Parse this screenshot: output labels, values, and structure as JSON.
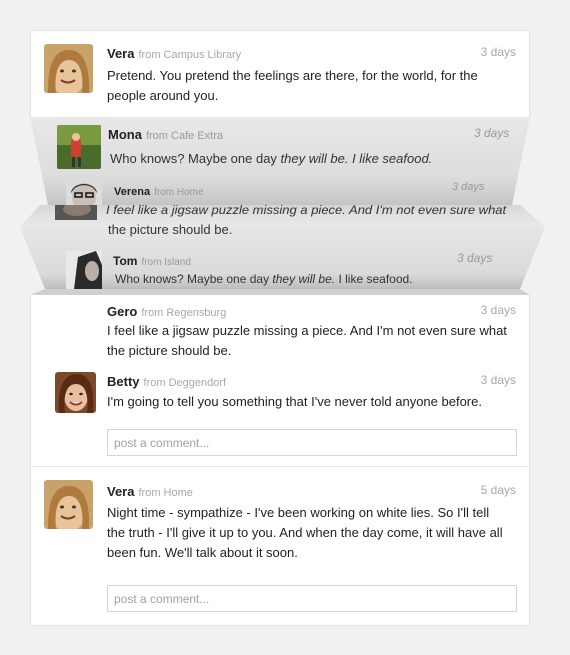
{
  "top_post": {
    "author": "Vera",
    "from": "from Campus Library",
    "time": "3 days",
    "text_line1": "Pretend. You pretend the feelings are there, for the world, for the",
    "text_line2": "people around you."
  },
  "folded": {
    "mona": {
      "author": "Mona",
      "from": "from Cafe Extra",
      "time": "3 days",
      "text_plain": "Who knows? Maybe one day ",
      "text_italic": "they will be. I like seafood."
    },
    "verena": {
      "author": "Verena",
      "from": "from Home",
      "time": "3 days"
    },
    "jigsaw_partial": {
      "line1": "I feel like a jigsaw puzzle missing a piece. And I'm not even sure what",
      "line2": "the picture should be."
    },
    "tom": {
      "author": "Tom",
      "from": "from Island",
      "time": "3 days",
      "text_plain": "Who knows? Maybe one day ",
      "text_italic": "they will be.",
      "text_tail": " I like seafood."
    }
  },
  "thread": {
    "gero": {
      "author": "Gero",
      "from": "from Regensburg",
      "time": "3 days",
      "text_line1": "I feel like a jigsaw puzzle missing a piece. And I'm not even sure what",
      "text_line2": "the picture should be."
    },
    "betty": {
      "author": "Betty",
      "from": "from Deggendorf",
      "time": "3 days",
      "text": "I'm going to tell you something that I've never told anyone before."
    },
    "comment_placeholder": "post a comment..."
  },
  "bottom_post": {
    "author": "Vera",
    "from": "from Home",
    "time": "5 days",
    "text_line1": "Night time - sympathize - I've been working on white lies. So I'll tell",
    "text_line2": "the truth - I'll give it up to you. And when the day come, it will have all",
    "text_line3": "been fun. We'll talk about it soon.",
    "comment_placeholder": "post a comment..."
  }
}
